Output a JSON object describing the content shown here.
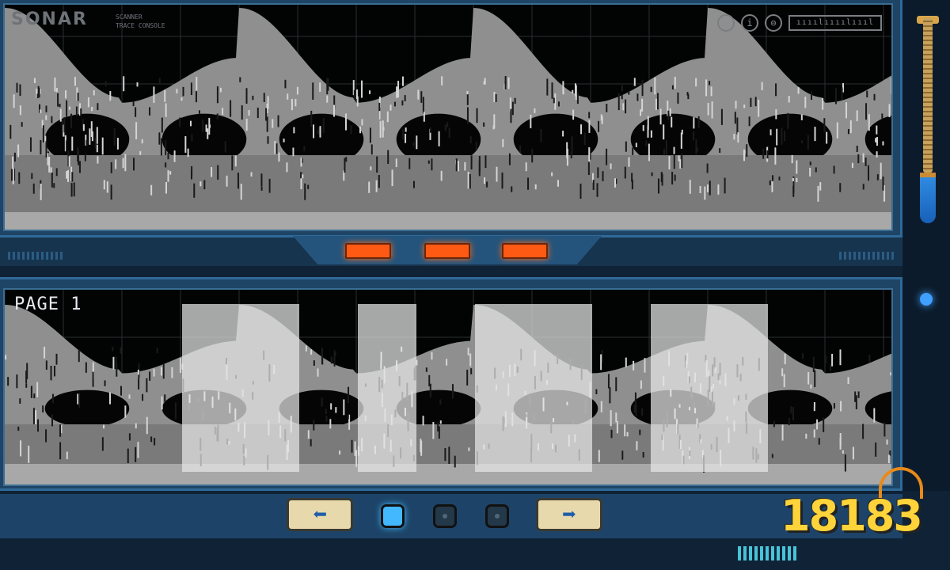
{
  "app": {
    "logo": "SONAR",
    "logo_sub_1": "SCANNER",
    "logo_sub_2": "TRACE CONSOLE"
  },
  "hud": {
    "icons": [
      "compass-icon",
      "info-icon",
      "back-icon"
    ],
    "meter_text": "ıııılıııılıııl"
  },
  "indicators": {
    "count": 3,
    "color": "#ff5a14"
  },
  "lower_screen": {
    "page_label": "PAGE 1"
  },
  "navigation": {
    "prev_symbol": "⬅",
    "next_symbol": "➡",
    "pages": [
      {
        "state": "active"
      },
      {
        "state": "inactive"
      },
      {
        "state": "inactive"
      }
    ]
  },
  "watermark": {
    "text": "18183"
  },
  "colors": {
    "panel": "#1e4466",
    "screen": "#020404",
    "wave_light": "#c9c9c9",
    "wave_mid": "#8f8f8f",
    "highlight": "#e6e6e6",
    "accent_blue": "#44b8ff",
    "accent_orange": "#ff5a14"
  }
}
